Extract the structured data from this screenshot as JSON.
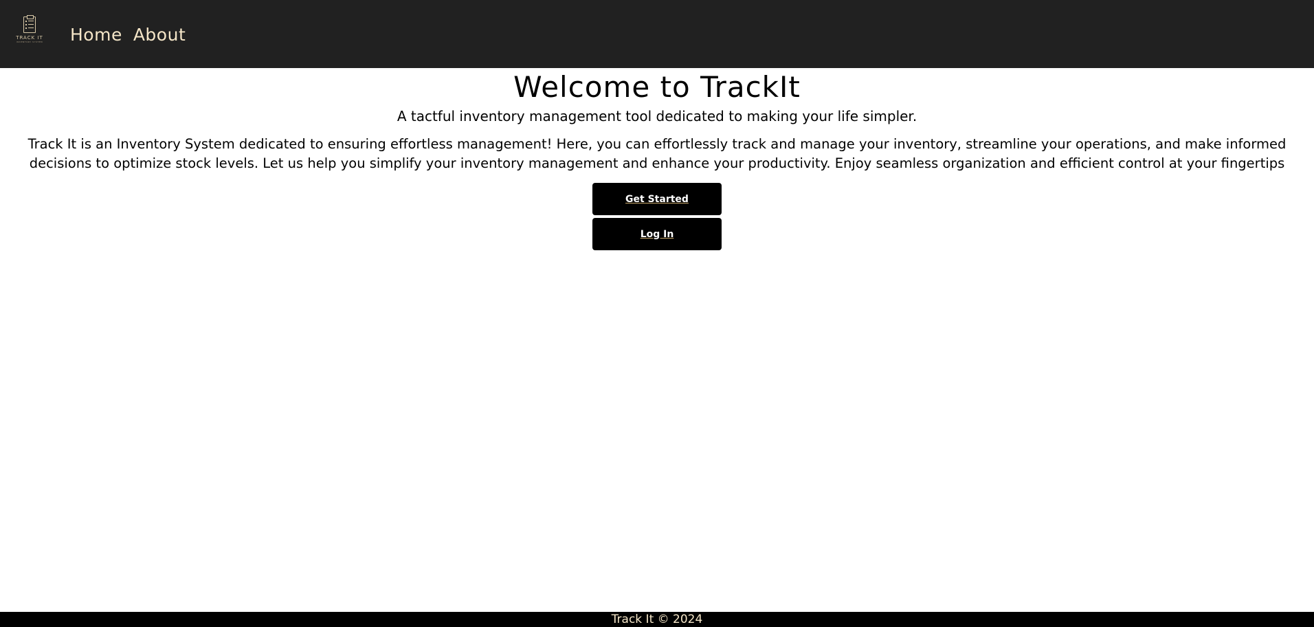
{
  "colors": {
    "navbar_bg": "#212121",
    "nav_link": "#f5e6c8",
    "button_bg": "#000000",
    "footer_bg": "#000000",
    "logo_accent": "#d9c9a8"
  },
  "logo": {
    "icon": "clipboard-checklist-icon",
    "text": "TRACK IT",
    "subtext": "INVENTORY SYSTEM"
  },
  "nav": {
    "home_label": "Home",
    "about_label": "About"
  },
  "main": {
    "title": "Welcome to TrackIt",
    "tagline": "A tactful inventory management tool dedicated to making your life simpler.",
    "description": "Track It is an Inventory System dedicated to ensuring effortless management! Here, you can effortlessly track and manage your inventory, streamline your operations, and make informed decisions to optimize stock levels. Let us help you simplify your inventory management and enhance your productivity. Enjoy seamless organization and efficient control at your fingertips",
    "get_started_label": "Get Started",
    "login_label": "Log In"
  },
  "footer": {
    "text": "Track It © 2024"
  }
}
